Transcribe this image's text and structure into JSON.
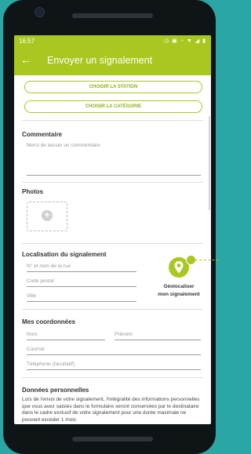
{
  "status_bar": {
    "time": "16:57",
    "icons": [
      "alarm-icon",
      "nfc-icon",
      "clock-icon",
      "wifi-icon",
      "signal-icon",
      "battery-icon"
    ]
  },
  "app_bar": {
    "title": "Envoyer un signalement",
    "back_icon": "arrow-left-icon"
  },
  "buttons": {
    "station": "CHOISIR LA STATION",
    "category": "CHOISIR LA CATÉGORIE"
  },
  "comment": {
    "title": "Commentaire",
    "placeholder": "Merci de laisser un commentaire"
  },
  "photos": {
    "title": "Photos",
    "add_icon": "plus-icon"
  },
  "location": {
    "title": "Localisation du signalement",
    "street_placeholder": "N° et nom de la rue",
    "postal_placeholder": "Code postal",
    "city_placeholder": "Ville",
    "geolocate_line1": "Géolocaliser",
    "geolocate_line2": "mon signalement",
    "geolocate_icon": "map-pin-icon"
  },
  "contact": {
    "title": "Mes coordonnées",
    "name_placeholder": "Nom",
    "firstname_placeholder": "Prénom",
    "email_placeholder": "Courriel",
    "phone_placeholder": "Téléphone (facultatif)"
  },
  "personal_data": {
    "title": "Données personnelles",
    "text": "Lors de l'envoi de votre signalement, l'intégralité des informations personnelles que vous avez saisies dans le formulaire seront conservées par le destinataire dans le cadre exclusif de votre signalement pour une durée maximale ne pouvant excéder 1 mois"
  },
  "colors": {
    "accent": "#a9c81f",
    "background": "#2aa6a4",
    "device": "#0f1416"
  }
}
